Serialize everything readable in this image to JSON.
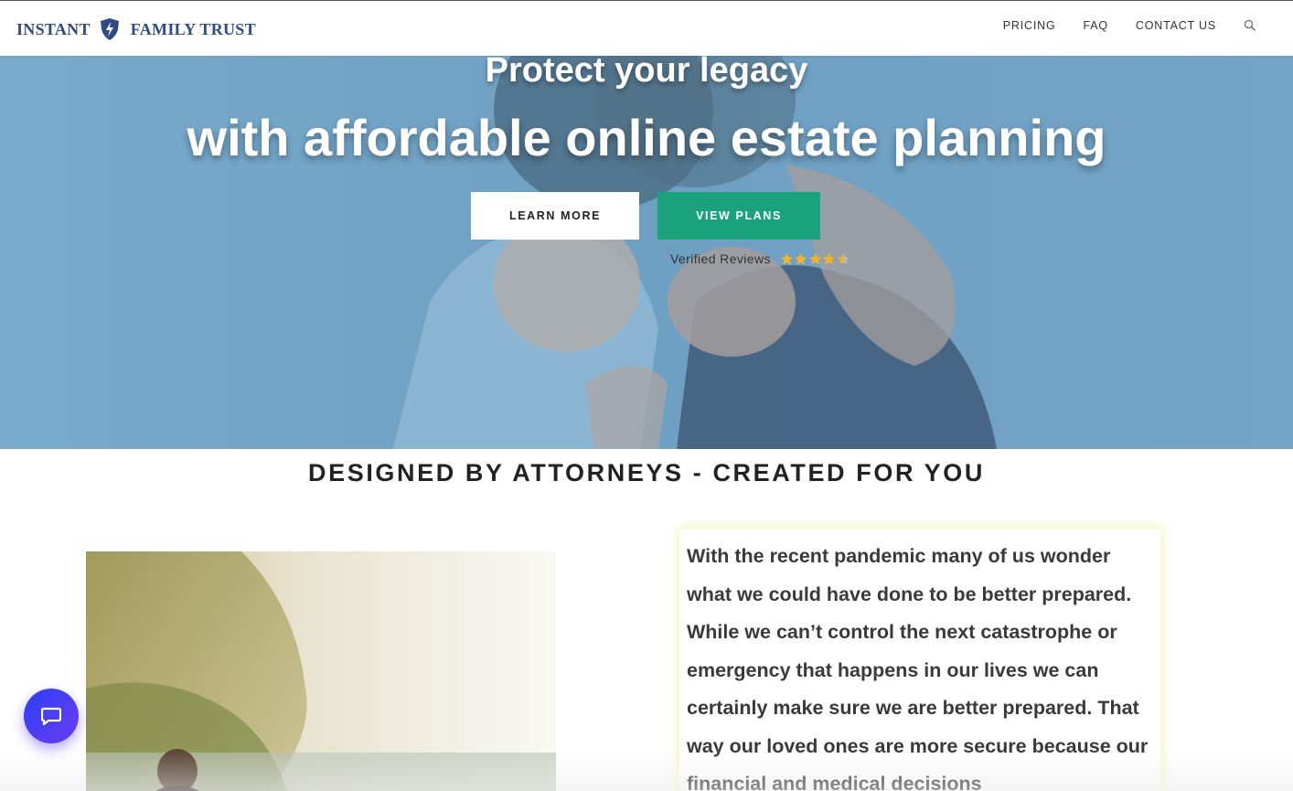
{
  "brand": {
    "name_left": "INSTANT",
    "name_right": "FAMILY TRUST",
    "logo_color": "#2f4a84"
  },
  "nav": {
    "items": [
      "PRICING",
      "FAQ",
      "CONTACT US"
    ],
    "search_icon": "search-icon"
  },
  "hero": {
    "title_line1": "Protect your legacy",
    "title_line2": "with affordable online estate planning",
    "learn_more_label": "LEARN MORE",
    "view_plans_label": "VIEW PLANS",
    "reviews_label": "Verified Reviews",
    "rating": 4.5,
    "rating_max": 5,
    "colors": {
      "primary_button": "#1aa27c",
      "star": "#f0b429"
    }
  },
  "section": {
    "heading": "DESIGNED BY ATTORNEYS - CREATED FOR YOU",
    "paragraph": "With the recent pandemic many of us wonder what we could have done to be better prepared. While we can’t control the next catastrophe or emergency that happens in our lives we can certainly make sure we are better prepared. That way our loved ones are more secure because our financial and medical decisions"
  },
  "chat": {
    "icon": "chat-bubble-icon"
  }
}
